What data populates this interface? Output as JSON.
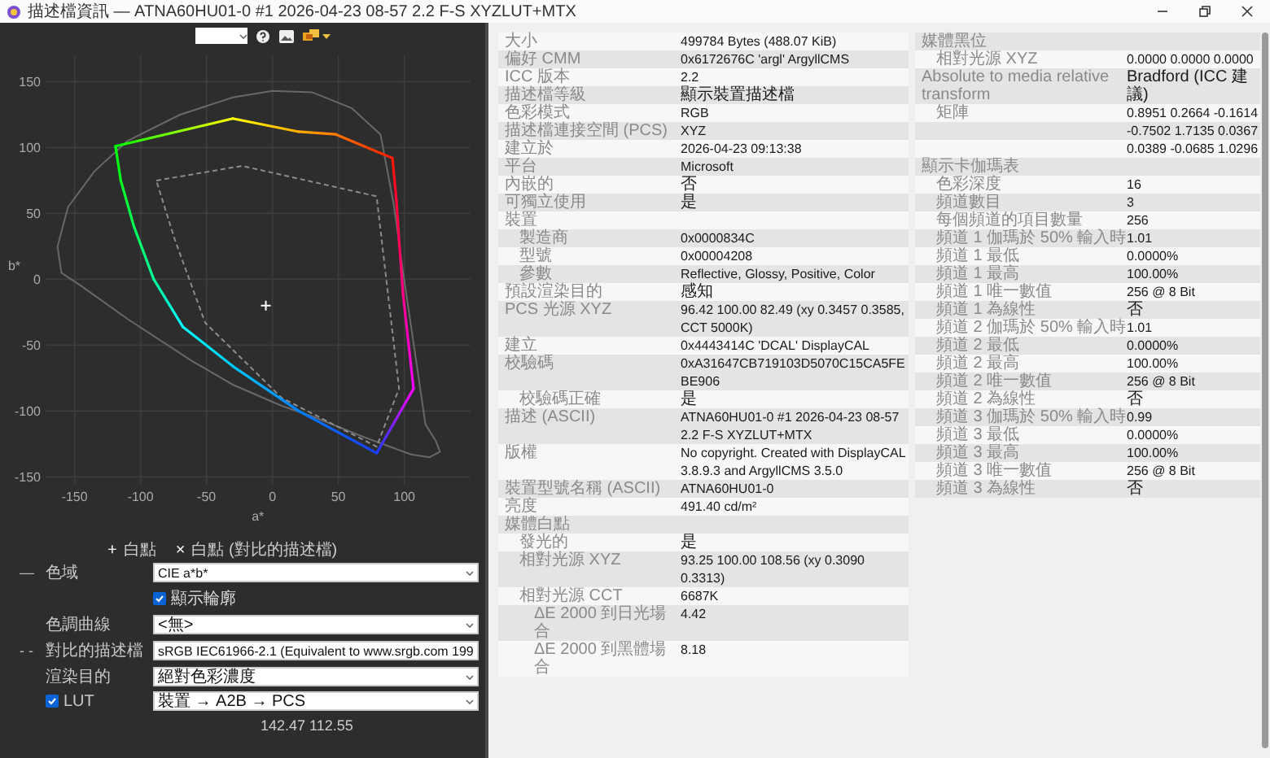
{
  "window": {
    "title": "描述檔資訊 — ATNA60HU01-0 #1 2026-04-23 08-57 2.2 F-S XYZLUT+MTX"
  },
  "chart": {
    "x_axis_label": "a*",
    "y_axis_label": "b*",
    "x_ticks": [
      "-150",
      "-100",
      "-50",
      "0",
      "50",
      "100"
    ],
    "y_ticks": [
      "150",
      "100",
      "50",
      "0",
      "-50",
      "-100",
      "-150"
    ]
  },
  "legend": [
    {
      "symbol": "+",
      "label": "白點"
    },
    {
      "symbol": "×",
      "label": "白點 (對比的描述檔)"
    }
  ],
  "controls": [
    {
      "kind": "select",
      "symbol": "—",
      "label": "色域",
      "value": "CIE a*b*"
    },
    {
      "kind": "checkbox",
      "label": "顯示輪廓",
      "checked": true
    },
    {
      "kind": "select",
      "label": "色調曲線",
      "value": "<無>"
    },
    {
      "kind": "select",
      "symbol": "- -",
      "label": "對比的描述檔",
      "value": "sRGB IEC61966-2.1 (Equivalent to www.srgb.com 199"
    },
    {
      "kind": "select",
      "label": "渲染目的",
      "value": "絕對色彩濃度"
    },
    {
      "kind": "checkbox-select",
      "label": "LUT",
      "checked": true,
      "value": "裝置 → A2B → PCS"
    }
  ],
  "cursor_position": "142.47 112.55",
  "properties": [
    {
      "label": "大小",
      "value": "499784 Bytes (488.07 KiB)"
    },
    {
      "label": "偏好 CMM",
      "value": "0x6172676C 'argl' ArgyllCMS"
    },
    {
      "label": "ICC 版本",
      "value": "2.2"
    },
    {
      "label": "描述檔等級",
      "value": "顯示裝置描述檔"
    },
    {
      "label": "色彩模式",
      "value": "RGB"
    },
    {
      "label": "描述檔連接空間 (PCS)",
      "value": "XYZ"
    },
    {
      "label": "建立於",
      "value": "2026-04-23 09:13:38"
    },
    {
      "label": "平台",
      "value": "Microsoft"
    },
    {
      "label": "內嵌的",
      "value": "否"
    },
    {
      "label": "可獨立使用",
      "value": "是"
    },
    {
      "label": "裝置",
      "children": [
        {
          "label": "製造商",
          "value": "0x0000834C"
        },
        {
          "label": "型號",
          "value": "0x00004208"
        },
        {
          "label": "參數",
          "value": "Reflective, Glossy, Positive, Color"
        }
      ]
    },
    {
      "label": "預設渲染目的",
      "value": "感知"
    },
    {
      "label": "PCS 光源 XYZ",
      "value": "96.42 100.00  82.49 (xy 0.3457 0.3585, CCT 5000K)"
    },
    {
      "label": "建立",
      "value": "0x4443414C 'DCAL' DisplayCAL"
    },
    {
      "label": "校驗碼",
      "value": "0xA31647CB719103D5070C15CA5FEBE906",
      "children": [
        {
          "label": "校驗碼正確",
          "value": "是"
        }
      ]
    },
    {
      "label": "描述 (ASCII)",
      "value": "ATNA60HU01-0 #1 2026-04-23 08-57 2.2 F-S XYZLUT+MTX"
    },
    {
      "label": "版權",
      "value": "No copyright. Created with DisplayCAL 3.8.9.3 and ArgyllCMS 3.5.0"
    },
    {
      "label": "裝置型號名稱 (ASCII)",
      "value": "ATNA60HU01-0"
    },
    {
      "label": "亮度",
      "value": "491.40 cd/m²"
    },
    {
      "label": "媒體白點",
      "children": [
        {
          "label": "發光的",
          "value": "是"
        },
        {
          "label": "相對光源 XYZ",
          "value": "93.25 100.00 108.56 (xy 0.3090 0.3313)"
        },
        {
          "label": "相對光源 CCT",
          "value": "6687K",
          "children": [
            {
              "label": "ΔE 2000 到日光場合",
              "value": "4.42"
            },
            {
              "label": "ΔE 2000 到黑體場合",
              "value": "8.18"
            }
          ]
        }
      ]
    },
    {
      "label": "媒體黑位",
      "children": [
        {
          "label": "相對光源 XYZ",
          "value": "0.0000 0.0000 0.0000"
        }
      ]
    },
    {
      "label": "Absolute to media relative transform",
      "value": "Bradford (ICC 建議)",
      "children": [
        {
          "label": "矩陣",
          "value": "0.8951 0.2664 -0.1614"
        },
        {
          "value": "-0.7502 1.7135 0.0367"
        },
        {
          "value": "0.0389 -0.0685 1.0296"
        }
      ]
    },
    {
      "label": "顯示卡伽瑪表",
      "children": [
        {
          "label": "色彩深度",
          "value": "16"
        },
        {
          "label": "頻道數目",
          "value": "3"
        },
        {
          "label": "每個頻道的項目數量",
          "value": "256"
        },
        {
          "label": "頻道 1 伽瑪於 50% 輸入時",
          "value": "1.01"
        },
        {
          "label": "頻道 1 最低",
          "value": "0.0000%"
        },
        {
          "label": "頻道 1 最高",
          "value": "100.00%"
        },
        {
          "label": "頻道 1 唯一數值",
          "value": "256 @ 8 Bit"
        },
        {
          "label": "頻道 1 為線性",
          "value": "否"
        },
        {
          "label": "頻道 2 伽瑪於 50% 輸入時",
          "value": "1.01"
        },
        {
          "label": "頻道 2 最低",
          "value": "0.0000%"
        },
        {
          "label": "頻道 2 最高",
          "value": "100.00%"
        },
        {
          "label": "頻道 2 唯一數值",
          "value": "256 @ 8 Bit"
        },
        {
          "label": "頻道 2 為線性",
          "value": "否"
        },
        {
          "label": "頻道 3 伽瑪於 50% 輸入時",
          "value": "0.99"
        },
        {
          "label": "頻道 3 最低",
          "value": "0.0000%"
        },
        {
          "label": "頻道 3 最高",
          "value": "100.00%"
        },
        {
          "label": "頻道 3 唯一數值",
          "value": "256 @ 8 Bit"
        },
        {
          "label": "頻道 3 為線性",
          "value": "否"
        }
      ]
    }
  ]
}
